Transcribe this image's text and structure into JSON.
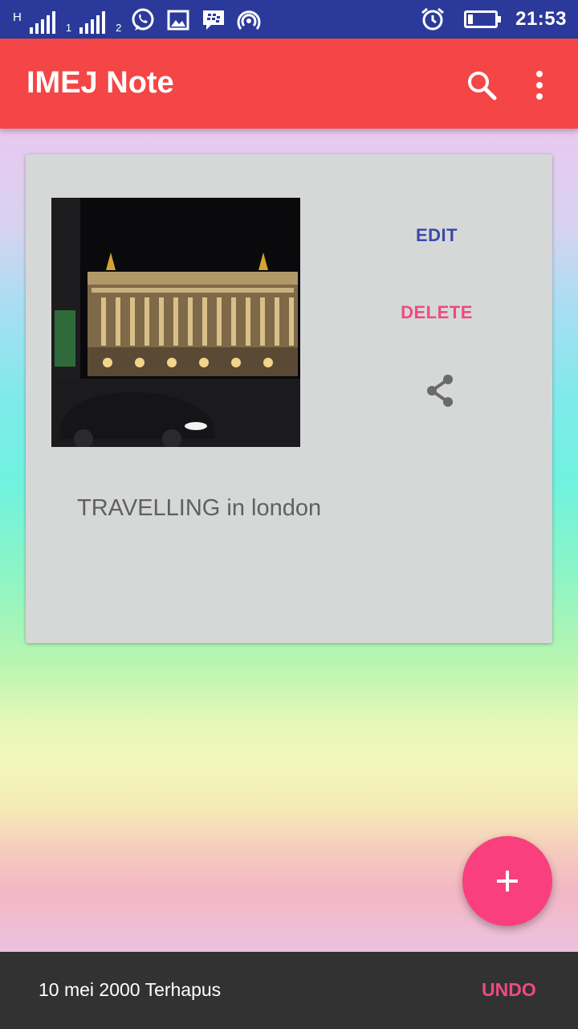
{
  "status_bar": {
    "network_type": "H",
    "sim1_label": "1",
    "sim2_label": "2",
    "time": "21:53"
  },
  "app_bar": {
    "title": "IMEJ Note",
    "search_icon": "search-icon",
    "more_icon": "more-vert-icon"
  },
  "note_card": {
    "edit_label": "EDIT",
    "delete_label": "DELETE",
    "share_icon": "share-icon",
    "text": "TRAVELLING in london"
  },
  "fab": {
    "icon": "plus-icon",
    "color": "#fa3f7f"
  },
  "snackbar": {
    "message": "10 mei 2000 Terhapus",
    "action_label": "UNDO"
  },
  "colors": {
    "status_bar": "#2b3a9a",
    "app_bar": "#f44646",
    "edit": "#3a4aa8",
    "delete": "#ef4a7f"
  }
}
